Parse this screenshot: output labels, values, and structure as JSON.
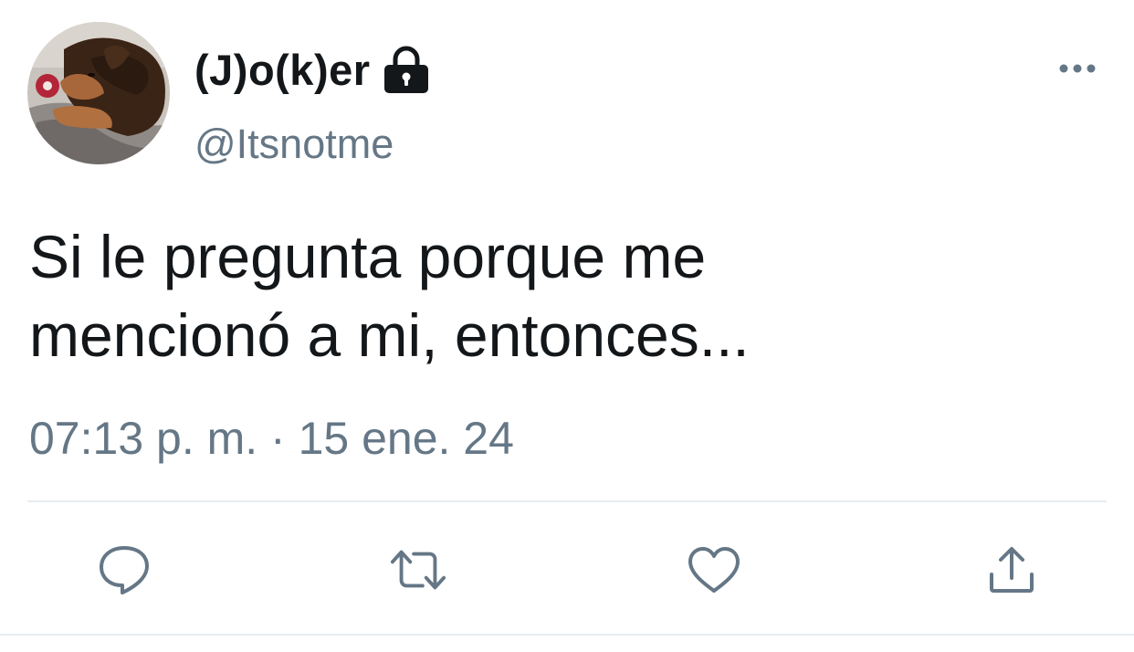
{
  "tweet": {
    "author": {
      "display_name": "(J)o(k)er",
      "handle": "@Itsnotme",
      "protected_icon": "lock-icon",
      "avatar": "dog-avatar"
    },
    "text_line_1": "Si le pregunta porque me",
    "text_line_2": "mencionó a mi, entonces...",
    "timestamp": "07:13 p. m. · 15 ene. 24"
  },
  "actions": {
    "more": "more-horizontal-icon",
    "reply": "reply-icon",
    "retweet": "retweet-icon",
    "like": "heart-icon",
    "share": "share-icon"
  },
  "colors": {
    "text_primary": "#14171a",
    "text_secondary": "#657786",
    "divider": "#e6ecf0"
  }
}
